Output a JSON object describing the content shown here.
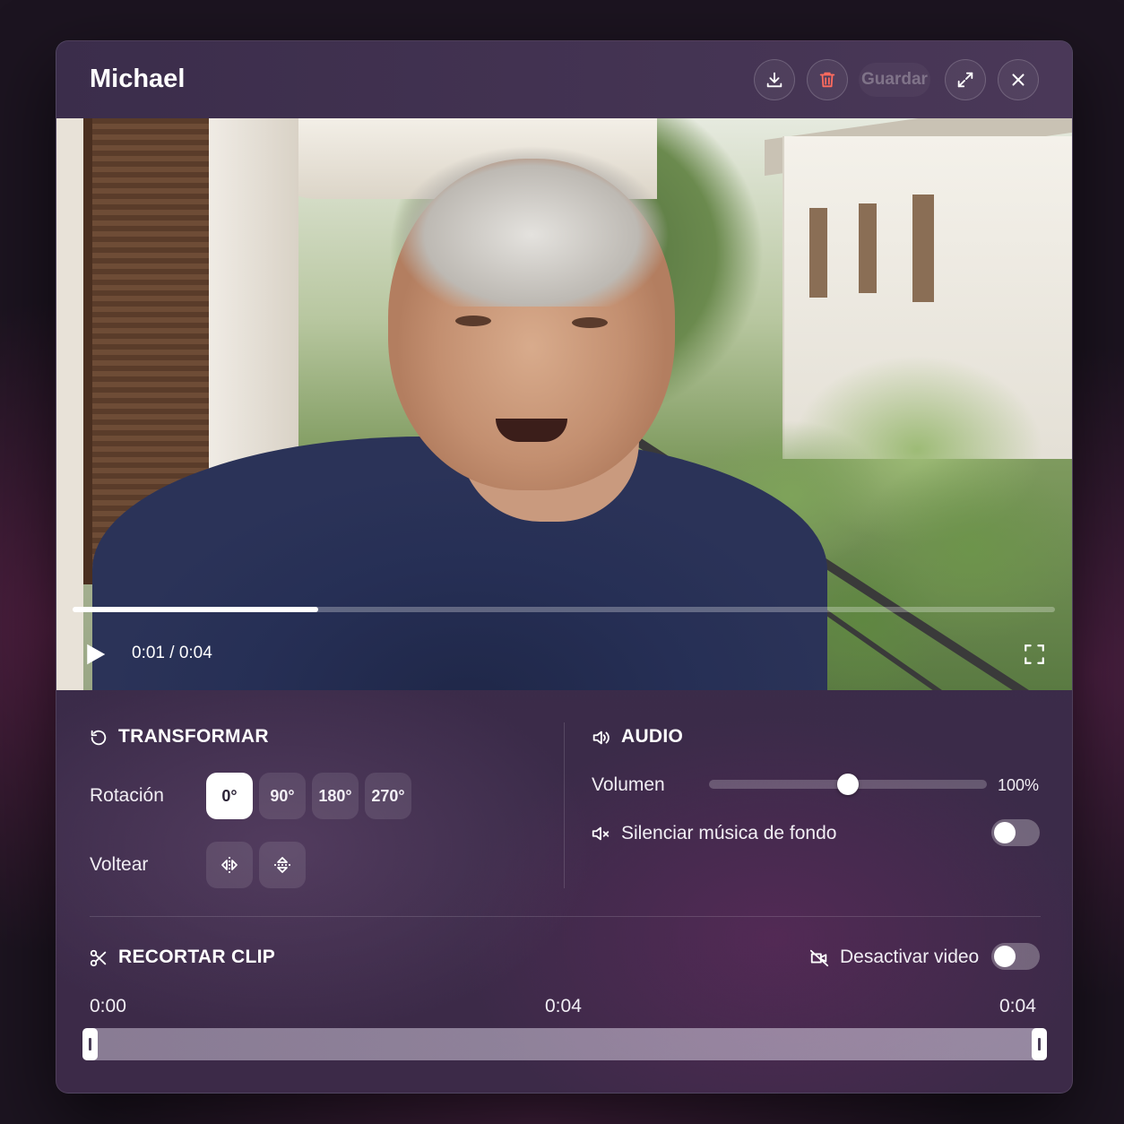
{
  "header": {
    "title": "Michael",
    "save_label": "Guardar"
  },
  "video": {
    "time": "0:01 / 0:04",
    "progress": 0.25
  },
  "transform": {
    "title": "TRANSFORMAR",
    "rotation_label": "Rotación",
    "rotation_options": [
      "0°",
      "90°",
      "180°",
      "270°"
    ],
    "rotation_selected": "0°",
    "flip_label": "Voltear"
  },
  "audio": {
    "title": "AUDIO",
    "volume_label": "Volumen",
    "volume_value": "100%",
    "volume_fraction": 0.5,
    "mute_music_label": "Silenciar música de fondo",
    "mute_music_on": false
  },
  "trim": {
    "title": "RECORTAR CLIP",
    "disable_video_label": "Desactivar video",
    "disable_video_on": false,
    "start": "0:00",
    "mid": "0:04",
    "end": "0:04"
  },
  "colors": {
    "accent": "#ffffff",
    "delete": "#ff6b5e",
    "panel": "#3e3150"
  },
  "icons": [
    "download-icon",
    "trash-icon",
    "expand-icon",
    "close-icon",
    "play-icon",
    "fullscreen-icon",
    "rotate-icon",
    "speaker-icon",
    "mute-icon",
    "scissors-icon",
    "video-off-icon",
    "flip-horizontal-icon",
    "flip-vertical-icon"
  ]
}
